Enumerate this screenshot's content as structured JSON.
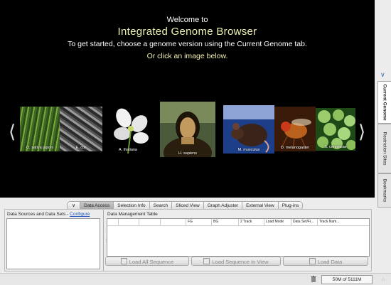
{
  "welcome": {
    "line1": "Welcome to",
    "title": "Integrated Genome Browser",
    "line3": "To get started, choose a genome version using the Current Genome tab.",
    "line4": "Or click an image below."
  },
  "carousel": {
    "items": [
      {
        "label": "O. sativa japoni",
        "color1": "#3f6a25",
        "color2": "#8fb04a"
      },
      {
        "label": "E. coli",
        "color1": "#333333",
        "color2": "#9a9a9a"
      },
      {
        "label": "A. thaliana",
        "color1": "#111111",
        "color2": "#e8e8e8"
      },
      {
        "label": "H. sapiens",
        "color1": "#3a2c12",
        "color2": "#a48454"
      },
      {
        "label": "M. musculus",
        "color1": "#1d3f8a",
        "color2": "#6c86c4"
      },
      {
        "label": "D. melanogaster",
        "color1": "#5a2c0e",
        "color2": "#c0651f"
      },
      {
        "label": "S. cerevisiae",
        "color1": "#2f6a24",
        "color2": "#a4d47a"
      }
    ]
  },
  "side_tabs": [
    "Current Genome",
    "Restriction Sites",
    "Bookmarks"
  ],
  "bottom_tabs": [
    "Data Access",
    "Selection Info",
    "Search",
    "Sliced View",
    "Graph Adjuster",
    "External View",
    "Plug-ins"
  ],
  "data_access": {
    "left_header": "Data Sources and Data Sets - ",
    "configure_link": "Configure",
    "right_header": "Data Management Table",
    "columns": [
      "",
      "",
      "",
      "",
      "FG",
      "BG",
      "2 Track",
      "Load Mode",
      "Data Set/Fi...",
      "Track Nam..."
    ],
    "buttons": {
      "load_all": "Load All Sequence",
      "load_in_view": "Load Sequence In View",
      "load_data": "Load Data"
    }
  },
  "status": {
    "memory": "50M of 5111M"
  }
}
